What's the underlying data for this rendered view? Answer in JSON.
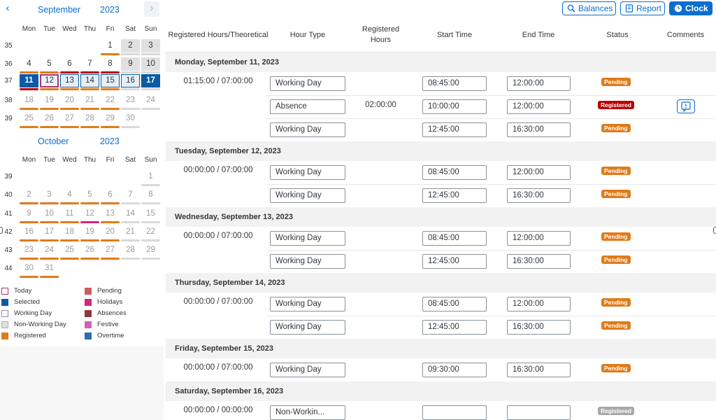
{
  "colors": {
    "accent": "#0a6ed1",
    "selected": "#0a5aa5",
    "registered": "#e07b1a",
    "pending": "#cd5c5c",
    "holiday": "#d4267a",
    "absence": "#8b3a3a",
    "festive": "#d35fb7",
    "overtime": "#2a6db0",
    "today": "#a3386f",
    "status_pending": "#e07b1a",
    "status_registered": "#bb0000",
    "status_registered_gray": "#a9a9a9",
    "nonworking": "#d9d9d9"
  },
  "calendar": {
    "nav_prev": "‹",
    "nav_next": "›",
    "weekday_labels": [
      "Mon",
      "Tue",
      "Wed",
      "Thu",
      "Fri",
      "Sat",
      "Sun"
    ],
    "months": [
      {
        "name": "September",
        "year": "2023",
        "weeks": [
          {
            "num": "35",
            "days": [
              null,
              null,
              null,
              null,
              {
                "d": "1",
                "bar": "registered"
              },
              {
                "d": "2",
                "we": true,
                "bar": "nonworking"
              },
              {
                "d": "3",
                "we": true,
                "bar": "nonworking"
              }
            ]
          },
          {
            "num": "36",
            "days": [
              {
                "d": "4",
                "bar": "registered"
              },
              {
                "d": "5",
                "bar": "registered"
              },
              {
                "d": "6",
                "bar": "absence_red"
              },
              {
                "d": "7",
                "bar": "absence_red"
              },
              {
                "d": "8",
                "bar": "absence_red"
              },
              {
                "d": "9",
                "we": true,
                "bar": "nonworking"
              },
              {
                "d": "10",
                "we": true,
                "bar": "nonworking"
              }
            ]
          },
          {
            "num": "37",
            "days": [
              {
                "d": "11",
                "state": "sel",
                "bar": "absence_red"
              },
              {
                "d": "12",
                "state": "today",
                "bar": "registered"
              },
              {
                "d": "13",
                "state": "selbox",
                "bar": "registered"
              },
              {
                "d": "14",
                "state": "selbox",
                "bar": "registered"
              },
              {
                "d": "15",
                "state": "selbox",
                "bar": "registered"
              },
              {
                "d": "16",
                "state": "selbox",
                "bar": "nonworking"
              },
              {
                "d": "17",
                "state": "sel",
                "bar": "nonworking"
              }
            ]
          },
          {
            "num": "38",
            "days": [
              {
                "d": "18",
                "muted": true,
                "bar": "registered"
              },
              {
                "d": "19",
                "muted": true,
                "bar": "registered"
              },
              {
                "d": "20",
                "muted": true,
                "bar": "registered"
              },
              {
                "d": "21",
                "muted": true,
                "bar": "registered"
              },
              {
                "d": "22",
                "muted": true,
                "bar": "registered"
              },
              {
                "d": "23",
                "muted": true,
                "bar": "nonworking"
              },
              {
                "d": "24",
                "muted": true,
                "bar": "nonworking"
              }
            ]
          },
          {
            "num": "39",
            "days": [
              {
                "d": "25",
                "muted": true,
                "bar": "registered"
              },
              {
                "d": "26",
                "muted": true,
                "bar": "registered"
              },
              {
                "d": "27",
                "muted": true,
                "bar": "registered"
              },
              {
                "d": "28",
                "muted": true,
                "bar": "registered"
              },
              {
                "d": "29",
                "muted": true,
                "bar": "registered"
              },
              {
                "d": "30",
                "muted": true,
                "bar": "nonworking"
              },
              null
            ]
          }
        ]
      },
      {
        "name": "October",
        "year": "2023",
        "weeks": [
          {
            "num": "39",
            "days": [
              null,
              null,
              null,
              null,
              null,
              null,
              {
                "d": "1",
                "muted": true,
                "bar": "nonworking"
              }
            ]
          },
          {
            "num": "40",
            "days": [
              {
                "d": "2",
                "muted": true,
                "bar": "registered"
              },
              {
                "d": "3",
                "muted": true,
                "bar": "registered"
              },
              {
                "d": "4",
                "muted": true,
                "bar": "registered"
              },
              {
                "d": "5",
                "muted": true,
                "bar": "registered"
              },
              {
                "d": "6",
                "muted": true,
                "bar": "registered"
              },
              {
                "d": "7",
                "muted": true,
                "bar": "nonworking"
              },
              {
                "d": "8",
                "muted": true,
                "bar": "nonworking"
              }
            ]
          },
          {
            "num": "41",
            "days": [
              {
                "d": "9",
                "muted": true,
                "bar": "registered"
              },
              {
                "d": "10",
                "muted": true,
                "bar": "registered"
              },
              {
                "d": "11",
                "muted": true,
                "bar": "registered"
              },
              {
                "d": "12",
                "muted": true,
                "bar": "holiday"
              },
              {
                "d": "13",
                "muted": true,
                "bar": "registered"
              },
              {
                "d": "14",
                "muted": true,
                "bar": "nonworking"
              },
              {
                "d": "15",
                "muted": true,
                "bar": "nonworking"
              }
            ]
          },
          {
            "num": "42",
            "days": [
              {
                "d": "16",
                "muted": true,
                "bar": "registered"
              },
              {
                "d": "17",
                "muted": true,
                "bar": "registered"
              },
              {
                "d": "18",
                "muted": true,
                "bar": "registered"
              },
              {
                "d": "19",
                "muted": true,
                "bar": "registered"
              },
              {
                "d": "20",
                "muted": true,
                "bar": "registered"
              },
              {
                "d": "21",
                "muted": true,
                "bar": "nonworking"
              },
              {
                "d": "22",
                "muted": true,
                "bar": "nonworking"
              }
            ]
          },
          {
            "num": "43",
            "days": [
              {
                "d": "23",
                "muted": true,
                "bar": "registered"
              },
              {
                "d": "24",
                "muted": true,
                "bar": "registered"
              },
              {
                "d": "25",
                "muted": true,
                "bar": "registered"
              },
              {
                "d": "26",
                "muted": true,
                "bar": "registered"
              },
              {
                "d": "27",
                "muted": true,
                "bar": "registered"
              },
              {
                "d": "28",
                "muted": true,
                "bar": "nonworking"
              },
              {
                "d": "29",
                "muted": true,
                "bar": "nonworking"
              }
            ]
          },
          {
            "num": "44",
            "days": [
              {
                "d": "30",
                "muted": true,
                "bar": "registered"
              },
              {
                "d": "31",
                "muted": true,
                "bar": "registered"
              },
              null,
              null,
              null,
              null,
              null
            ]
          }
        ]
      }
    ],
    "legend": [
      {
        "label": "Today",
        "swatch": "today"
      },
      {
        "label": "Pending",
        "swatch": "pending"
      },
      {
        "label": "Selected",
        "swatch": "selected"
      },
      {
        "label": "Holidays",
        "swatch": "holiday"
      },
      {
        "label": "Working Day",
        "swatch": "working"
      },
      {
        "label": "Absences",
        "swatch": "absence"
      },
      {
        "label": "Non-Working Day",
        "swatch": "nonworking"
      },
      {
        "label": "Festive",
        "swatch": "festive"
      },
      {
        "label": "Registered",
        "swatch": "registered"
      },
      {
        "label": "Overtime",
        "swatch": "overtime"
      }
    ]
  },
  "toolbar": {
    "balances_label": "Balances",
    "report_label": "Report",
    "clock_label": "Clock"
  },
  "table": {
    "columns": [
      "Registered Hours/Theoretical",
      "Hour Type",
      "Registered Hours",
      "Start Time",
      "End Time",
      "Status",
      "Comments"
    ],
    "days": [
      {
        "title": "Monday, September 11, 2023",
        "rows": [
          {
            "reg": "01:15:00 / 07:00:00",
            "type": "Working Day",
            "hours": "",
            "start": "08:45:00",
            "end": "12:00:00",
            "status": "Pending",
            "status_kind": "pending",
            "comment": false
          },
          {
            "reg": "",
            "type": "Absence",
            "hours": "02:00:00",
            "start": "10:00:00",
            "end": "12:00:00",
            "status": "Registered",
            "status_kind": "registered",
            "comment": true
          },
          {
            "reg": "",
            "type": "Working Day",
            "hours": "",
            "start": "12:45:00",
            "end": "16:30:00",
            "status": "Pending",
            "status_kind": "pending",
            "comment": false
          }
        ]
      },
      {
        "title": "Tuesday, September 12, 2023",
        "rows": [
          {
            "reg": "00:00:00 / 07:00:00",
            "type": "Working Day",
            "hours": "",
            "start": "08:45:00",
            "end": "12:00:00",
            "status": "Pending",
            "status_kind": "pending",
            "comment": false
          },
          {
            "reg": "",
            "type": "Working Day",
            "hours": "",
            "start": "12:45:00",
            "end": "16:30:00",
            "status": "Pending",
            "status_kind": "pending",
            "comment": false
          }
        ]
      },
      {
        "title": "Wednesday, September 13, 2023",
        "rows": [
          {
            "reg": "00:00:00 / 07:00:00",
            "type": "Working Day",
            "hours": "",
            "start": "08:45:00",
            "end": "12:00:00",
            "status": "Pending",
            "status_kind": "pending",
            "comment": false
          },
          {
            "reg": "",
            "type": "Working Day",
            "hours": "",
            "start": "12:45:00",
            "end": "16:30:00",
            "status": "Pending",
            "status_kind": "pending",
            "comment": false
          }
        ]
      },
      {
        "title": "Thursday, September 14, 2023",
        "rows": [
          {
            "reg": "00:00:00 / 07:00:00",
            "type": "Working Day",
            "hours": "",
            "start": "08:45:00",
            "end": "12:00:00",
            "status": "Pending",
            "status_kind": "pending",
            "comment": false
          },
          {
            "reg": "",
            "type": "Working Day",
            "hours": "",
            "start": "12:45:00",
            "end": "16:30:00",
            "status": "Pending",
            "status_kind": "pending",
            "comment": false
          }
        ]
      },
      {
        "title": "Friday, September 15, 2023",
        "rows": [
          {
            "reg": "00:00:00 / 07:00:00",
            "type": "Working Day",
            "hours": "",
            "start": "09:30:00",
            "end": "16:30:00",
            "status": "Pending",
            "status_kind": "pending",
            "comment": false
          }
        ]
      },
      {
        "title": "Saturday, September 16, 2023",
        "rows": [
          {
            "reg": "00:00:00 / 00:00:00",
            "type": "Non-Workin...",
            "hours": "",
            "start": "",
            "end": "",
            "status": "Registered",
            "status_kind": "registered_gray",
            "comment": false
          }
        ]
      }
    ]
  }
}
